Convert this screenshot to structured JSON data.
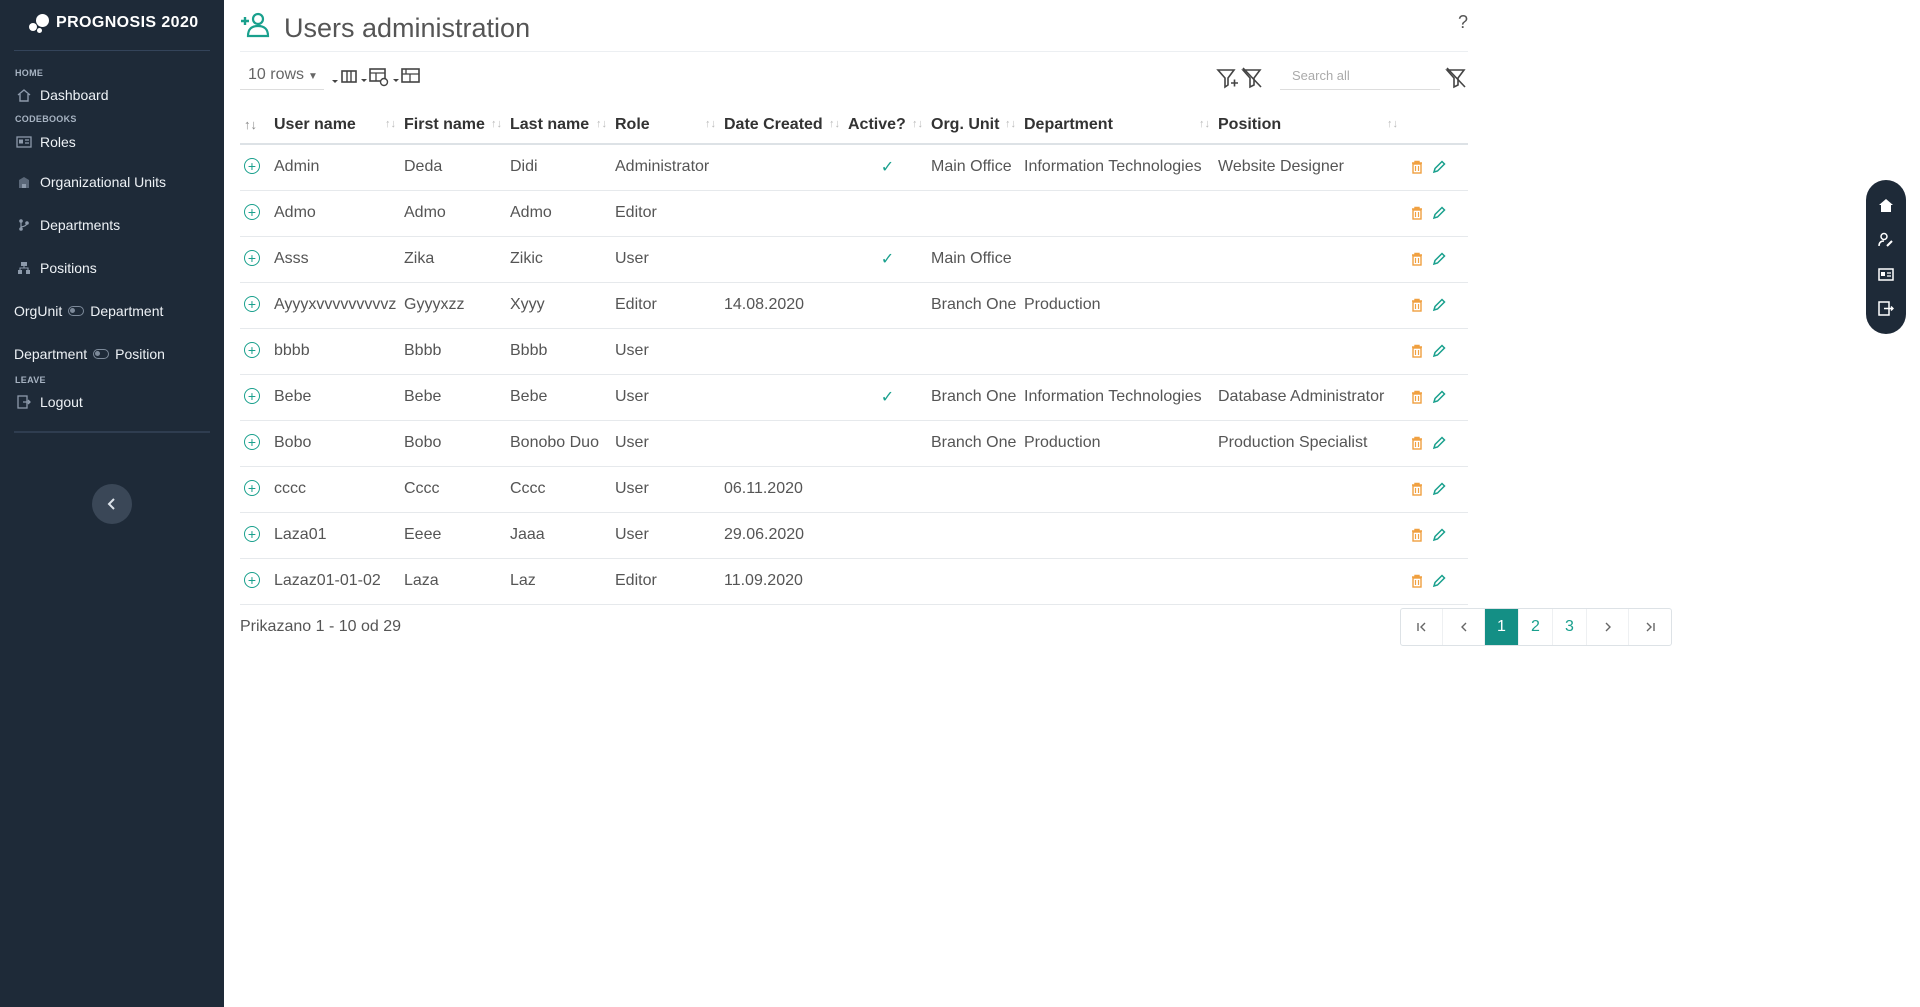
{
  "app": {
    "brand": "PROGNOSIS 2020"
  },
  "sidebar": {
    "sections": {
      "home": "HOME",
      "codebooks": "CODEBOOKS",
      "leave": "LEAVE"
    },
    "items": {
      "dashboard": "Dashboard",
      "roles": "Roles",
      "org_units": "Organizational Units",
      "departments": "Departments",
      "positions": "Positions",
      "orgunit_dept_a": "OrgUnit",
      "orgunit_dept_b": "Department",
      "dept_pos_a": "Department",
      "dept_pos_b": "Position",
      "logout": "Logout"
    },
    "collapse_icon": "chevron-left-icon"
  },
  "header": {
    "title": "Users administration",
    "help": "?"
  },
  "toolbar": {
    "rows_label": "10 rows",
    "search_placeholder": "Search all",
    "icons": [
      "columns-icon",
      "table-settings-icon",
      "table-layout-icon",
      "filter-add-icon",
      "filter-remove-icon",
      "clear-filter-icon"
    ]
  },
  "table": {
    "columns": [
      "User name",
      "First name",
      "Last name",
      "Role",
      "Date Created",
      "Active?",
      "Org. Unit",
      "Department",
      "Position"
    ],
    "rows": [
      {
        "user": "Admin",
        "first": "Deda",
        "last": "Didi",
        "role": "Administrator",
        "date": "",
        "active": "✓",
        "org": "Main Office",
        "dept": "Information Technologies",
        "pos": "Website Designer"
      },
      {
        "user": "Admo",
        "first": "Admo",
        "last": "Admo",
        "role": "Editor",
        "date": "",
        "active": "",
        "org": "",
        "dept": "",
        "pos": ""
      },
      {
        "user": "Asss",
        "first": "Zika",
        "last": "Zikic",
        "role": "User",
        "date": "",
        "active": "✓",
        "org": "Main Office",
        "dept": "",
        "pos": ""
      },
      {
        "user": "Ayyyxvvvvvvvvvz",
        "first": "Gyyyxzz",
        "last": "Xyyy",
        "role": "Editor",
        "date": "14.08.2020",
        "active": "",
        "org": "Branch One",
        "dept": "Production",
        "pos": ""
      },
      {
        "user": "bbbb",
        "first": "Bbbb",
        "last": "Bbbb",
        "role": "User",
        "date": "",
        "active": "",
        "org": "",
        "dept": "",
        "pos": ""
      },
      {
        "user": "Bebe",
        "first": "Bebe",
        "last": "Bebe",
        "role": "User",
        "date": "",
        "active": "✓",
        "org": "Branch One",
        "dept": "Information Technologies",
        "pos": "Database Administrator"
      },
      {
        "user": "Bobo",
        "first": "Bobo",
        "last": "Bonobo Duo",
        "role": "User",
        "date": "",
        "active": "",
        "org": "Branch One",
        "dept": "Production",
        "pos": "Production Specialist"
      },
      {
        "user": "cccc",
        "first": "Cccc",
        "last": "Cccc",
        "role": "User",
        "date": "06.11.2020",
        "active": "",
        "org": "",
        "dept": "",
        "pos": ""
      },
      {
        "user": "Laza01",
        "first": "Eeee",
        "last": "Jaaa",
        "role": "User",
        "date": "29.06.2020",
        "active": "",
        "org": "",
        "dept": "",
        "pos": ""
      },
      {
        "user": "Lazaz01-01-02",
        "first": "Laza",
        "last": "Laz",
        "role": "Editor",
        "date": "11.09.2020",
        "active": "",
        "org": "",
        "dept": "",
        "pos": ""
      }
    ]
  },
  "footer": {
    "info": "Prikazano 1 - 10 od 29"
  },
  "pagination": {
    "pages": [
      "1",
      "2",
      "3"
    ],
    "current": "1"
  },
  "dock": {
    "icons": [
      "home-icon",
      "user-edit-icon",
      "id-card-icon",
      "export-icon"
    ]
  },
  "colors": {
    "sidebar_bg": "#1e2a38",
    "accent": "#19a08d",
    "delete": "#f0a040"
  }
}
